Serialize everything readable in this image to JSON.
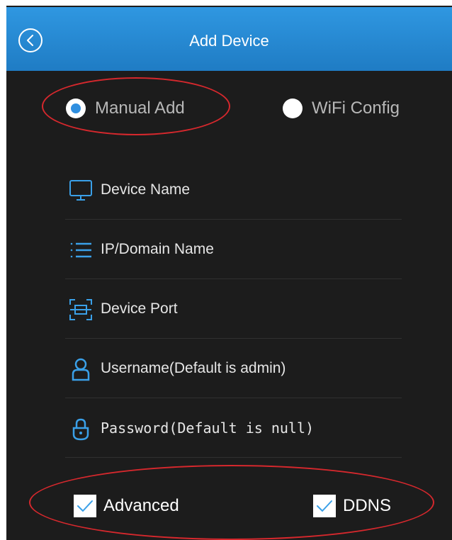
{
  "header": {
    "title": "Add Device",
    "color": "#2a8ad4"
  },
  "add_mode": {
    "options": [
      {
        "label": "Manual Add",
        "selected": true
      },
      {
        "label": "WiFi Config",
        "selected": false
      }
    ]
  },
  "form": {
    "fields": [
      {
        "icon": "monitor-icon",
        "placeholder": "Device Name"
      },
      {
        "icon": "list-icon",
        "placeholder": "IP/Domain Name"
      },
      {
        "icon": "port-icon",
        "placeholder": "Device Port"
      },
      {
        "icon": "user-icon",
        "placeholder": "Username(Default is admin)"
      },
      {
        "icon": "lock-icon",
        "placeholder": "Password(Default is null)"
      }
    ]
  },
  "options": {
    "advanced": {
      "label": "Advanced",
      "checked": true
    },
    "ddns": {
      "label": "DDNS",
      "checked": true
    }
  },
  "colors": {
    "accent": "#3aa0e8",
    "annotation": "#d6282d",
    "background": "#1c1c1c"
  }
}
